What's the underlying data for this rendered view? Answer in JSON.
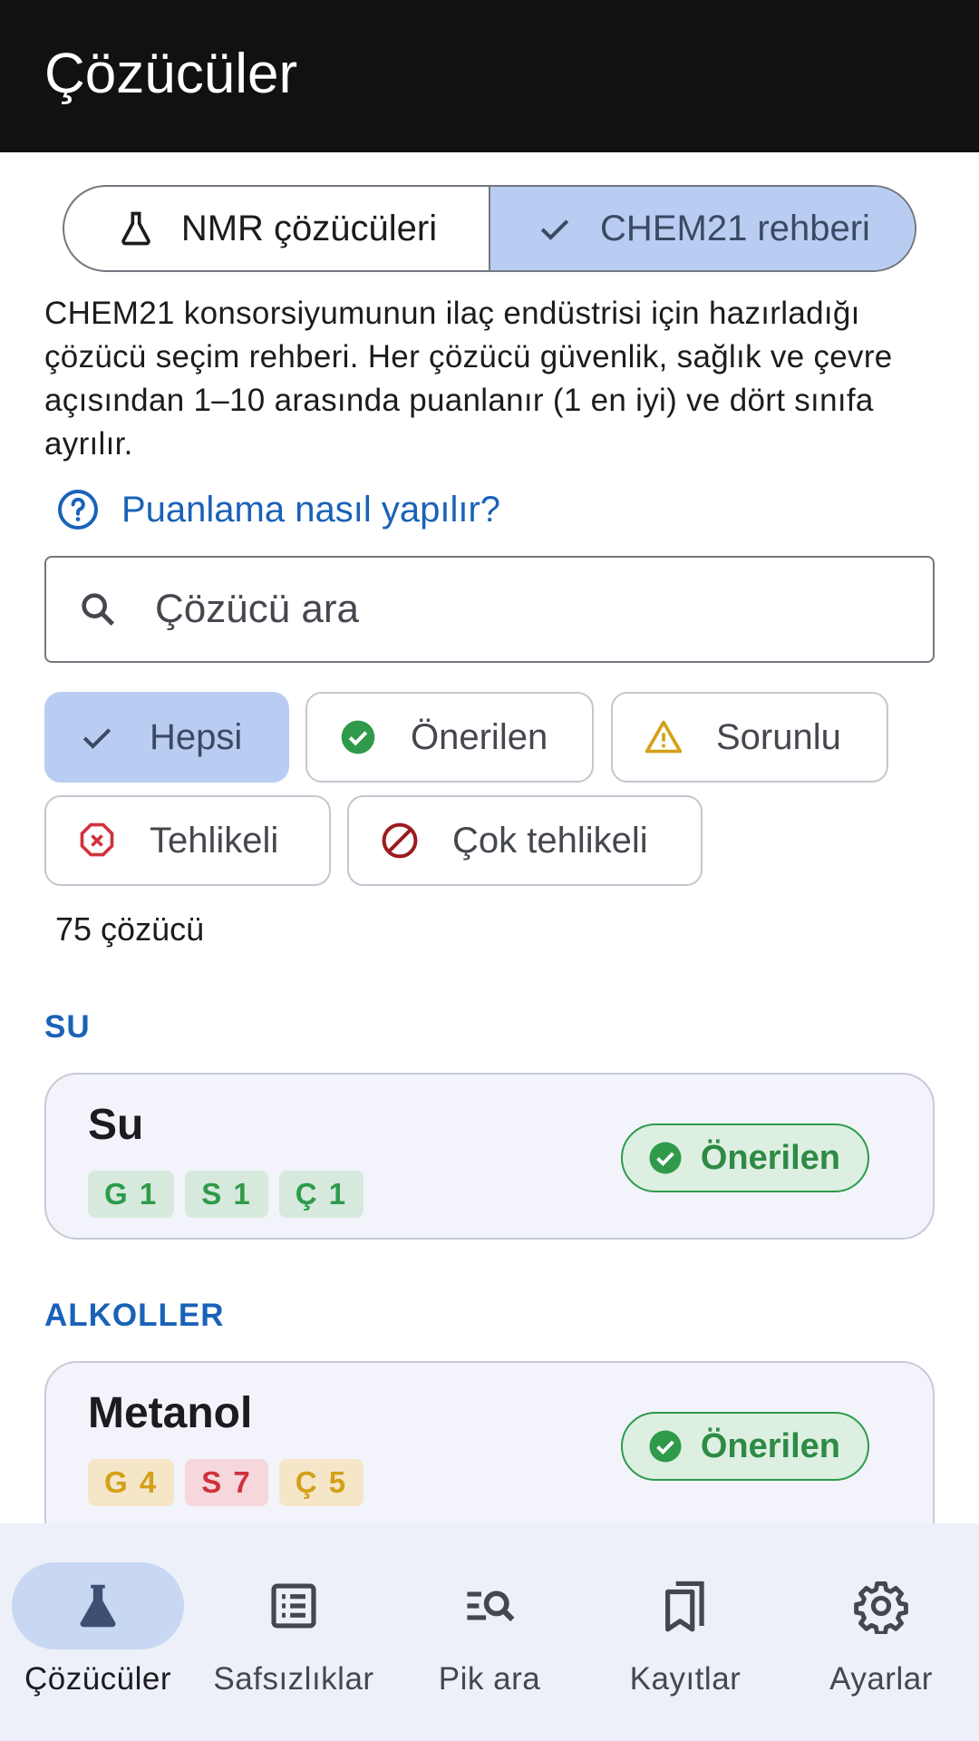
{
  "app_bar": {
    "title": "Çözücüler"
  },
  "segmented": [
    {
      "label": "NMR çözücüleri",
      "icon": "flask-icon",
      "selected": false
    },
    {
      "label": "CHEM21 rehberi",
      "icon": "check-icon",
      "selected": true
    }
  ],
  "description": "CHEM21 konsorsiyumunun ilaç endüstrisi için hazırladığı çözücü seçim rehberi. Her çözücü güvenlik, sağlık ve çevre açısından 1–10 arasında puanlanır (1 en iyi) ve dört sınıfa ayrılır.",
  "help_link": "Puanlama nasıl yapılır?",
  "search": {
    "placeholder": "Çözücü ara",
    "value": ""
  },
  "filters": [
    {
      "label": "Hepsi",
      "icon": "check-icon",
      "selected": true
    },
    {
      "label": "Önerilen",
      "icon": "check-circle-icon",
      "selected": false
    },
    {
      "label": "Sorunlu",
      "icon": "warning-icon",
      "selected": false
    },
    {
      "label": "Tehlikeli",
      "icon": "error-octagon-icon",
      "selected": false
    },
    {
      "label": "Çok tehlikeli",
      "icon": "block-icon",
      "selected": false
    }
  ],
  "count_text": "75 çözücü",
  "sections": [
    {
      "title": "SU",
      "items": [
        {
          "name": "Su",
          "scores": [
            "G 1",
            "S 1",
            "Ç 1"
          ],
          "score_levels": [
            "good",
            "good",
            "good"
          ],
          "badge": "Önerilen"
        }
      ]
    },
    {
      "title": "ALKOLLER",
      "items": [
        {
          "name": "Metanol",
          "scores": [
            "G 4",
            "S 7",
            "Ç 5"
          ],
          "score_levels": [
            "warn",
            "bad",
            "warn"
          ],
          "badge": "Önerilen"
        }
      ]
    }
  ],
  "bottom_nav": [
    {
      "label": "Çözücüler",
      "icon": "flask-icon",
      "active": true
    },
    {
      "label": "Safsızlıklar",
      "icon": "list-icon",
      "active": false
    },
    {
      "label": "Pik ara",
      "icon": "manage-search-icon",
      "active": false
    },
    {
      "label": "Kayıtlar",
      "icon": "bookmarks-icon",
      "active": false
    },
    {
      "label": "Ayarlar",
      "icon": "gear-icon",
      "active": false
    }
  ],
  "colors": {
    "app_bar": "#111111",
    "accent": "#1a62b8",
    "selected_container": "#b9cdf2",
    "recommended": "#2e9a4a",
    "warning": "#d4a017",
    "danger": "#d0323c",
    "nav_background": "#edf0f9"
  }
}
